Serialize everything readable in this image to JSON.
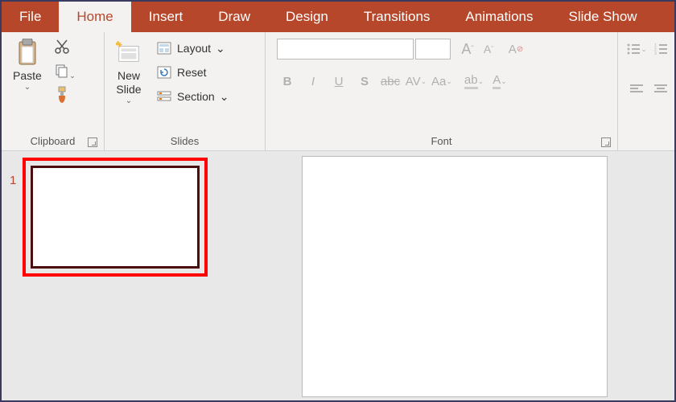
{
  "tabs": [
    "File",
    "Home",
    "Insert",
    "Draw",
    "Design",
    "Transitions",
    "Animations",
    "Slide Show"
  ],
  "activeTab": "Home",
  "clipboard": {
    "paste": "Paste",
    "label": "Clipboard"
  },
  "slides": {
    "newSlide": "New\nSlide",
    "layout": "Layout",
    "reset": "Reset",
    "section": "Section",
    "label": "Slides"
  },
  "font": {
    "label": "Font"
  },
  "slideNumber": "1"
}
